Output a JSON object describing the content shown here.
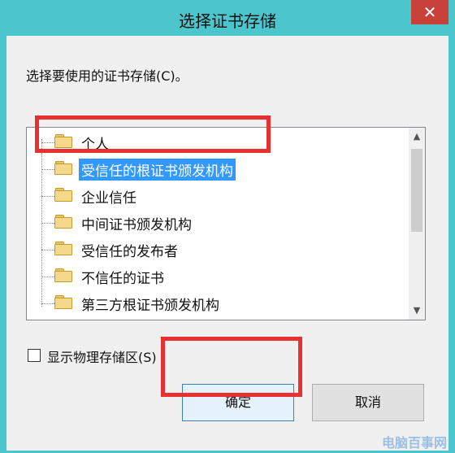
{
  "window": {
    "title": "选择证书存储",
    "close_glyph": "✕"
  },
  "prompt": "选择要使用的证书存储(C)。",
  "tree": {
    "items": [
      {
        "label": "个人"
      },
      {
        "label": "受信任的根证书颁发机构"
      },
      {
        "label": "企业信任"
      },
      {
        "label": "中间证书颁发机构"
      },
      {
        "label": "受信任的发布者"
      },
      {
        "label": "不信任的证书"
      },
      {
        "label": "第三方根证书颁发机构"
      }
    ],
    "selected_item": "受信任的根证书颁发机构"
  },
  "show_physical": {
    "label": "显示物理存储区(S)",
    "checked": false
  },
  "buttons": {
    "ok": "确定",
    "cancel": "取消"
  },
  "colors": {
    "titlebar": "#4cc6cc",
    "close": "#c7403a",
    "highlight": "#3399ff",
    "annotation": "#e8302f"
  },
  "watermark": "电脑百事网"
}
